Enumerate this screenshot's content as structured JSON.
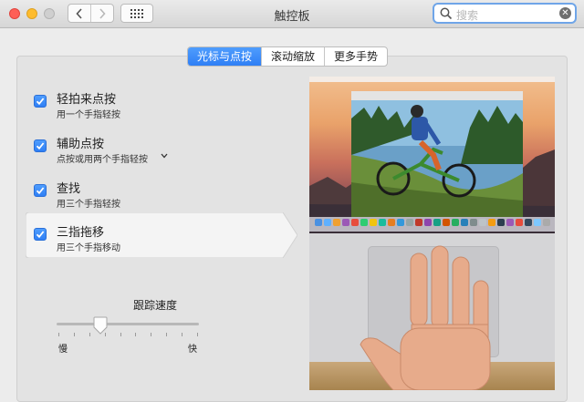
{
  "window": {
    "title": "触控板",
    "search_placeholder": "搜索",
    "nav": {
      "back": "‹",
      "forward": "›"
    }
  },
  "tabs": [
    {
      "label": "光标与点按",
      "active": true
    },
    {
      "label": "滚动缩放",
      "active": false
    },
    {
      "label": "更多手势",
      "active": false
    }
  ],
  "options": [
    {
      "title": "轻拍来点按",
      "subtitle": "用一个手指轻按",
      "checked": true
    },
    {
      "title": "辅助点按",
      "subtitle": "点按或用两个手指轻按",
      "checked": true,
      "has_dropdown": true
    },
    {
      "title": "查找",
      "subtitle": "用三个手指轻按",
      "checked": true
    },
    {
      "title": "三指拖移",
      "subtitle": "用三个手指移动",
      "checked": true,
      "selected": true
    }
  ],
  "tracking_speed": {
    "label": "跟踪速度",
    "min_label": "慢",
    "max_label": "快",
    "value_fraction": 0.3,
    "tick_count": 10
  },
  "colors": {
    "accent": "#2f7ff5",
    "panel": "#e3e3e3",
    "window_bg": "#ececec",
    "close": "#fe5f57",
    "minimize": "#febc2e"
  }
}
